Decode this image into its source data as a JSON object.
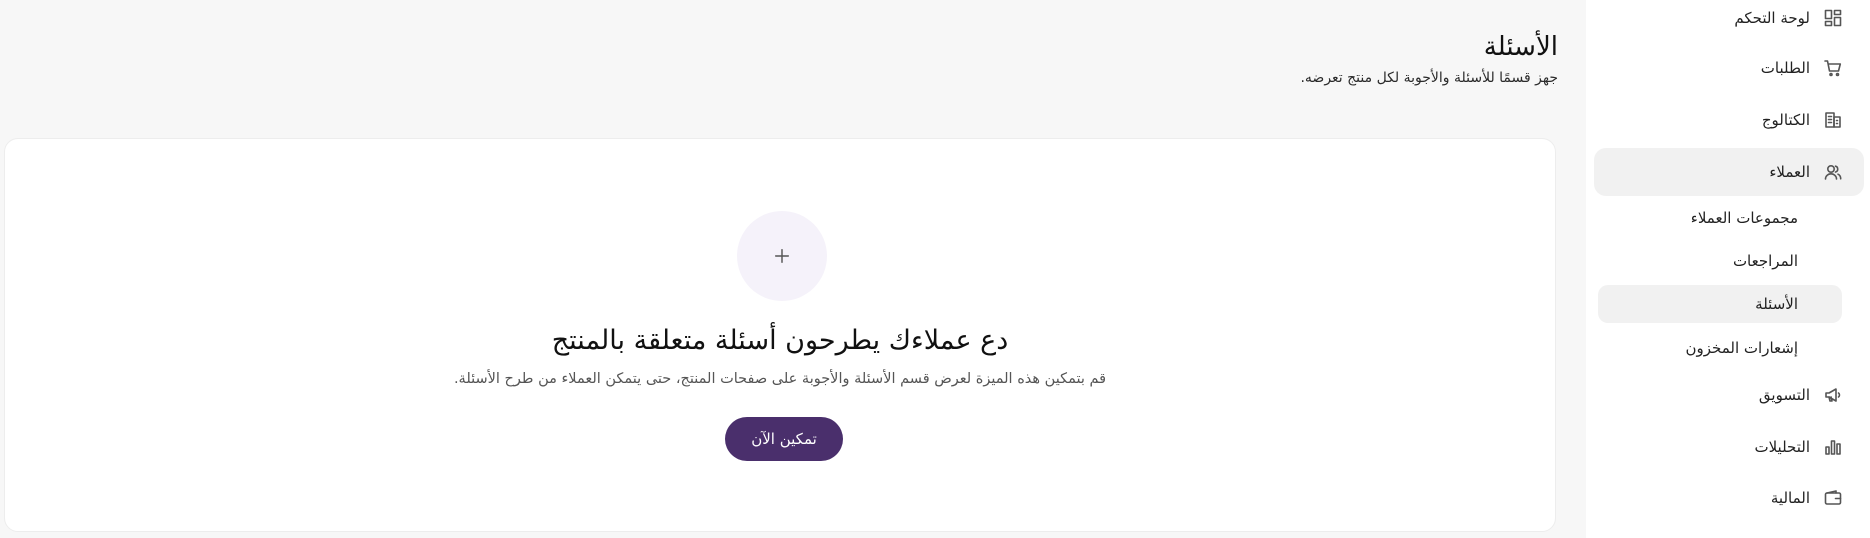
{
  "sidebar": {
    "items": [
      {
        "label": "لوحة التحكم",
        "icon": "dashboard-icon"
      },
      {
        "label": "الطلبات",
        "icon": "cart-icon"
      },
      {
        "label": "الكتالوج",
        "icon": "catalog-icon"
      },
      {
        "label": "العملاء",
        "icon": "users-icon",
        "active": true
      },
      {
        "label": "التسويق",
        "icon": "megaphone-icon"
      },
      {
        "label": "التحليلات",
        "icon": "bar-chart-icon"
      },
      {
        "label": "المالية",
        "icon": "wallet-icon"
      }
    ],
    "customer_subitems": [
      {
        "label": "مجموعات العملاء"
      },
      {
        "label": "المراجعات"
      },
      {
        "label": "الأسئلة",
        "selected": true
      },
      {
        "label": "إشعارات المخزون"
      }
    ]
  },
  "header": {
    "title": "الأسئلة",
    "subtitle": "جهز قسمًا للأسئلة والأجوبة لكل منتج تعرضه."
  },
  "empty_state": {
    "icon": "plus-icon",
    "title": "دع عملاءك يطرحون أسئلة متعلقة بالمنتج",
    "description": "قم بتمكين هذه الميزة لعرض قسم الأسئلة والأجوبة على صفحات المنتج، حتى يتمكن العملاء من طرح الأسئلة.",
    "button_label": "تمكين الآن"
  },
  "colors": {
    "primary_button": "#4a2f6c",
    "icon_circle_bg": "#f5f2fa",
    "page_bg": "#f7f7f7",
    "active_item_bg": "#f1f1f1"
  }
}
